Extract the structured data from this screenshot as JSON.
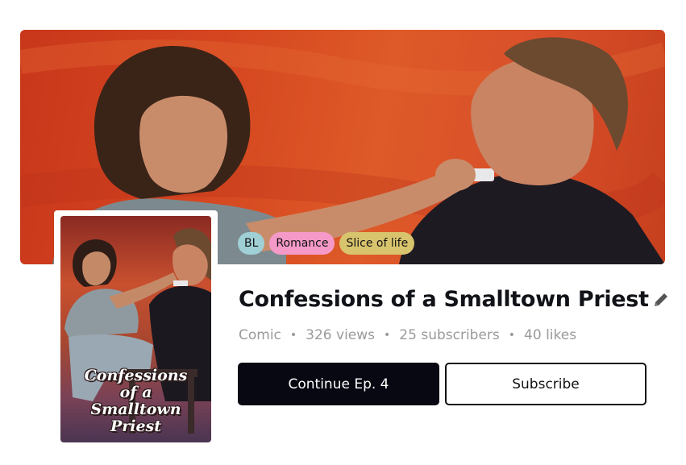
{
  "banner": {
    "alt": "Banner artwork"
  },
  "cover": {
    "title_lines": [
      "Confessions",
      "of a",
      "Smalltown",
      "Priest"
    ]
  },
  "tags": [
    {
      "label": "BL",
      "color": "#9fd0d6"
    },
    {
      "label": "Romance",
      "color": "#f59ac8"
    },
    {
      "label": "Slice of life",
      "color": "#d9c46e"
    }
  ],
  "title": "Confessions of a Smalltown Priest",
  "meta": {
    "type": "Comic",
    "views": "326 views",
    "subscribers": "25 subscribers",
    "likes": "40 likes"
  },
  "actions": {
    "continue_label": "Continue Ep. 4",
    "subscribe_label": "Subscribe"
  },
  "colors": {
    "primary_button": "#080812",
    "meta_text": "#9a9a9a"
  },
  "icons": {
    "edit": "pencil-icon"
  }
}
